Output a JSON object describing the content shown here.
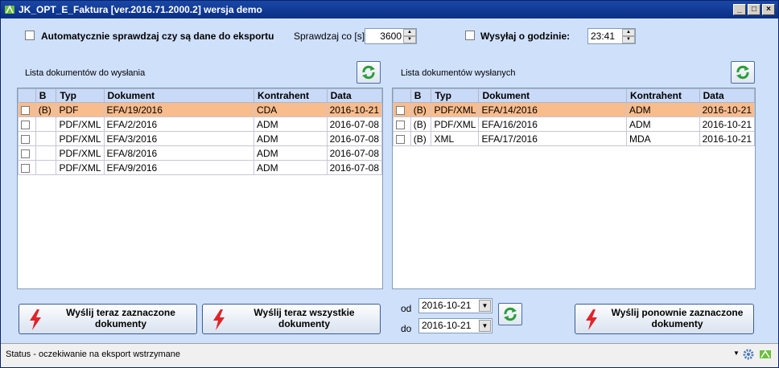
{
  "window": {
    "title": "JK_OPT_E_Faktura [ver.2016.71.2000.2]  wersja demo",
    "minimize": "_",
    "maximize": "□",
    "close": "×"
  },
  "options": {
    "auto_check_label": "Automatycznie sprawdzaj czy są dane do eksportu",
    "check_every_label": "Sprawdzaj co [s]",
    "check_every_value": "3600",
    "send_at_label": "Wysyłaj o godzinie:",
    "send_at_value": "23:41"
  },
  "left_panel": {
    "title": "Lista dokumentów do wysłania",
    "columns": [
      "",
      "B",
      "Typ",
      "Dokument",
      "Kontrahent",
      "Data"
    ],
    "rows": [
      {
        "b": "(B)",
        "typ": "PDF",
        "dokument": "EFA/19/2016",
        "kontrahent": "CDA",
        "data": "2016-10-21"
      },
      {
        "b": "",
        "typ": "PDF/XML",
        "dokument": "EFA/2/2016",
        "kontrahent": "ADM",
        "data": "2016-07-08"
      },
      {
        "b": "",
        "typ": "PDF/XML",
        "dokument": "EFA/3/2016",
        "kontrahent": "ADM",
        "data": "2016-07-08"
      },
      {
        "b": "",
        "typ": "PDF/XML",
        "dokument": "EFA/8/2016",
        "kontrahent": "ADM",
        "data": "2016-07-08"
      },
      {
        "b": "",
        "typ": "PDF/XML",
        "dokument": "EFA/9/2016",
        "kontrahent": "ADM",
        "data": "2016-07-08"
      }
    ]
  },
  "right_panel": {
    "title": "Lista dokumentów wysłanych",
    "columns": [
      "",
      "B",
      "Typ",
      "Dokument",
      "Kontrahent",
      "Data"
    ],
    "rows": [
      {
        "b": "(B)",
        "typ": "PDF/XML",
        "dokument": "EFA/14/2016",
        "kontrahent": "ADM",
        "data": "2016-10-21"
      },
      {
        "b": "(B)",
        "typ": "PDF/XML",
        "dokument": "EFA/16/2016",
        "kontrahent": "ADM",
        "data": "2016-10-21"
      },
      {
        "b": "(B)",
        "typ": "XML",
        "dokument": "EFA/17/2016",
        "kontrahent": "MDA",
        "data": "2016-10-21"
      }
    ]
  },
  "actions": {
    "send_selected": "Wyślij teraz zaznaczone dokumenty",
    "send_all": "Wyślij teraz wszystkie dokumenty",
    "resend_selected": "Wyślij ponownie zaznaczone dokumenty",
    "from_label": "od",
    "to_label": "do",
    "from_date": "2016-10-21",
    "to_date": "2016-10-21"
  },
  "status": {
    "text": "Status  - oczekiwanie na eksport wstrzymane"
  },
  "colors": {
    "selected_row": "#f9bc8c",
    "background": "#cfe0fb",
    "titlebar": "#0a2f86"
  }
}
